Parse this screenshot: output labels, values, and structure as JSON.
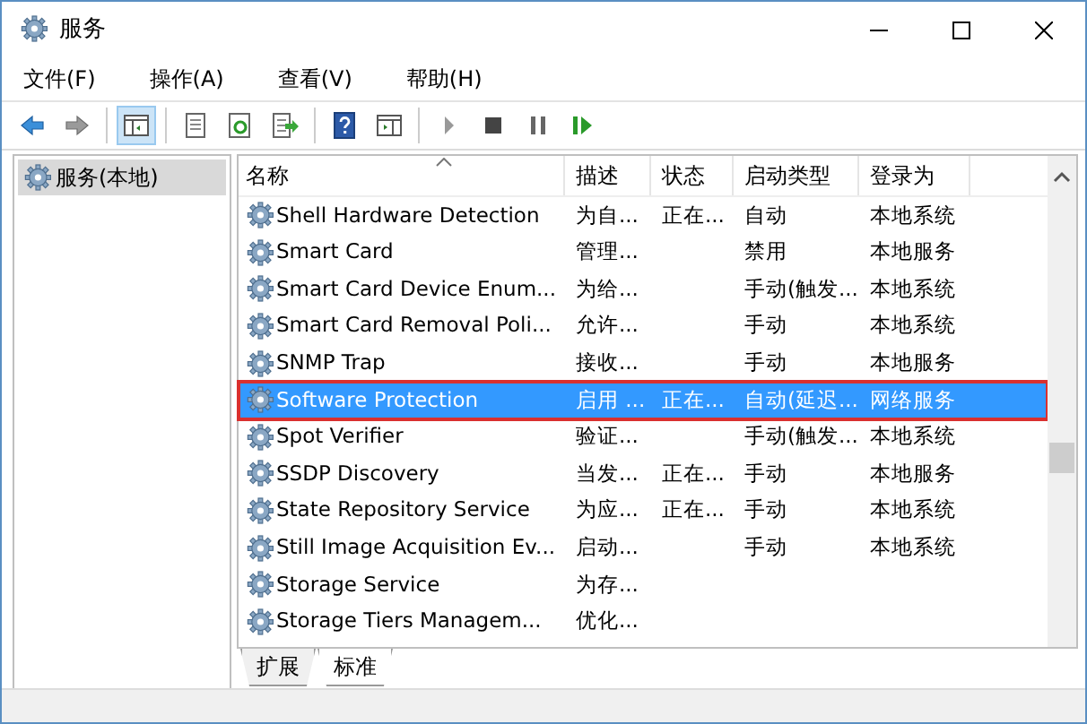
{
  "window": {
    "title": "服务"
  },
  "menu": [
    {
      "label": "文件(F)"
    },
    {
      "label": "操作(A)"
    },
    {
      "label": "查看(V)"
    },
    {
      "label": "帮助(H)"
    }
  ],
  "toolbar": [
    {
      "kind": "back"
    },
    {
      "kind": "forward"
    },
    {
      "kind": "sep"
    },
    {
      "kind": "tree",
      "pressed": true
    },
    {
      "kind": "sep"
    },
    {
      "kind": "properties"
    },
    {
      "kind": "refresh"
    },
    {
      "kind": "export"
    },
    {
      "kind": "sep"
    },
    {
      "kind": "help"
    },
    {
      "kind": "pane"
    },
    {
      "kind": "sep"
    },
    {
      "kind": "play"
    },
    {
      "kind": "stop"
    },
    {
      "kind": "pause"
    },
    {
      "kind": "resume"
    }
  ],
  "tree": {
    "items": [
      {
        "label": "服务(本地)",
        "selected": true
      }
    ]
  },
  "table": {
    "columns": [
      "名称",
      "描述",
      "状态",
      "启动类型",
      "登录为"
    ],
    "rows": [
      {
        "name": "Shell Hardware Detection",
        "description": "为自...",
        "status": "正在...",
        "startup": "自动",
        "logon": "本地系统",
        "selected": false
      },
      {
        "name": "Smart Card",
        "description": "管理...",
        "status": "",
        "startup": "禁用",
        "logon": "本地服务",
        "selected": false
      },
      {
        "name": "Smart Card Device Enum...",
        "description": "为给...",
        "status": "",
        "startup": "手动(触发...",
        "logon": "本地系统",
        "selected": false
      },
      {
        "name": "Smart Card Removal Poli...",
        "description": "允许...",
        "status": "",
        "startup": "手动",
        "logon": "本地系统",
        "selected": false
      },
      {
        "name": "SNMP Trap",
        "description": "接收...",
        "status": "",
        "startup": "手动",
        "logon": "本地服务",
        "selected": false
      },
      {
        "name": "Software Protection",
        "description": "启用 ...",
        "status": "正在...",
        "startup": "自动(延迟...",
        "logon": "网络服务",
        "selected": true
      },
      {
        "name": "Spot Verifier",
        "description": "验证...",
        "status": "",
        "startup": "手动(触发...",
        "logon": "本地系统",
        "selected": false
      },
      {
        "name": "SSDP Discovery",
        "description": "当发...",
        "status": "正在...",
        "startup": "手动",
        "logon": "本地服务",
        "selected": false
      },
      {
        "name": "State Repository Service",
        "description": "为应...",
        "status": "正在...",
        "startup": "手动",
        "logon": "本地系统",
        "selected": false
      },
      {
        "name": "Still Image Acquisition Ev...",
        "description": "启动...",
        "status": "",
        "startup": "手动",
        "logon": "本地系统",
        "selected": false
      },
      {
        "name": "Storage Service",
        "description": "为存...",
        "status": "",
        "startup": "",
        "logon": "",
        "selected": false
      },
      {
        "name": "Storage Tiers Managem...",
        "description": "优化...",
        "status": "",
        "startup": "",
        "logon": "",
        "selected": false
      }
    ]
  },
  "view_tabs": [
    {
      "label": "扩展",
      "selected": false
    },
    {
      "label": "标准",
      "selected": true
    }
  ]
}
